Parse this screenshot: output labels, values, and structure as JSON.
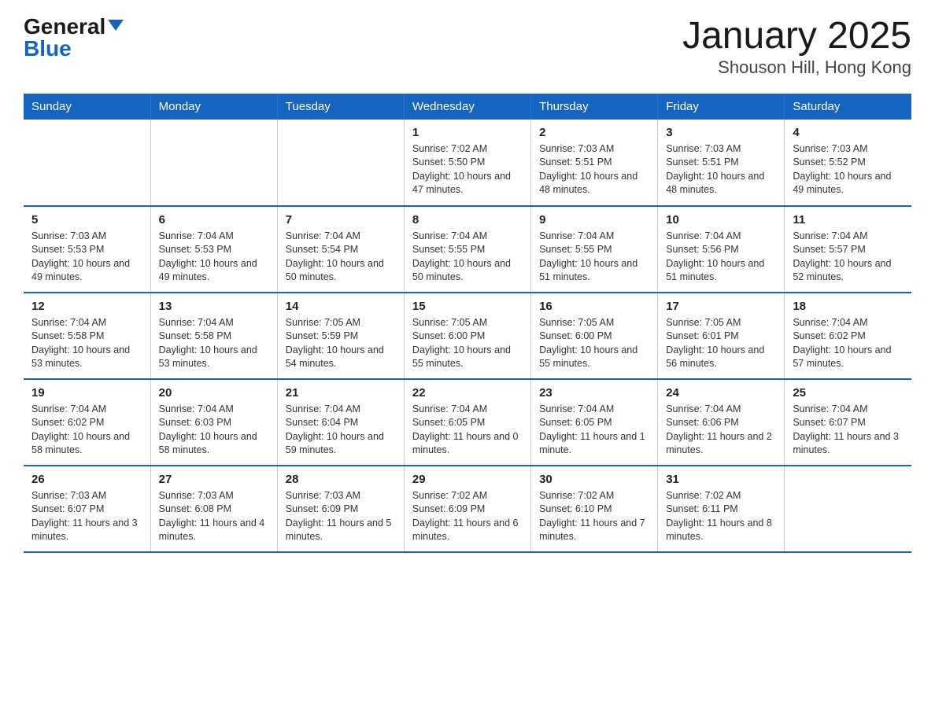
{
  "logo": {
    "general": "General",
    "blue": "Blue"
  },
  "title": "January 2025",
  "subtitle": "Shouson Hill, Hong Kong",
  "days_of_week": [
    "Sunday",
    "Monday",
    "Tuesday",
    "Wednesday",
    "Thursday",
    "Friday",
    "Saturday"
  ],
  "weeks": [
    [
      {
        "day": "",
        "info": ""
      },
      {
        "day": "",
        "info": ""
      },
      {
        "day": "",
        "info": ""
      },
      {
        "day": "1",
        "info": "Sunrise: 7:02 AM\nSunset: 5:50 PM\nDaylight: 10 hours and 47 minutes."
      },
      {
        "day": "2",
        "info": "Sunrise: 7:03 AM\nSunset: 5:51 PM\nDaylight: 10 hours and 48 minutes."
      },
      {
        "day": "3",
        "info": "Sunrise: 7:03 AM\nSunset: 5:51 PM\nDaylight: 10 hours and 48 minutes."
      },
      {
        "day": "4",
        "info": "Sunrise: 7:03 AM\nSunset: 5:52 PM\nDaylight: 10 hours and 49 minutes."
      }
    ],
    [
      {
        "day": "5",
        "info": "Sunrise: 7:03 AM\nSunset: 5:53 PM\nDaylight: 10 hours and 49 minutes."
      },
      {
        "day": "6",
        "info": "Sunrise: 7:04 AM\nSunset: 5:53 PM\nDaylight: 10 hours and 49 minutes."
      },
      {
        "day": "7",
        "info": "Sunrise: 7:04 AM\nSunset: 5:54 PM\nDaylight: 10 hours and 50 minutes."
      },
      {
        "day": "8",
        "info": "Sunrise: 7:04 AM\nSunset: 5:55 PM\nDaylight: 10 hours and 50 minutes."
      },
      {
        "day": "9",
        "info": "Sunrise: 7:04 AM\nSunset: 5:55 PM\nDaylight: 10 hours and 51 minutes."
      },
      {
        "day": "10",
        "info": "Sunrise: 7:04 AM\nSunset: 5:56 PM\nDaylight: 10 hours and 51 minutes."
      },
      {
        "day": "11",
        "info": "Sunrise: 7:04 AM\nSunset: 5:57 PM\nDaylight: 10 hours and 52 minutes."
      }
    ],
    [
      {
        "day": "12",
        "info": "Sunrise: 7:04 AM\nSunset: 5:58 PM\nDaylight: 10 hours and 53 minutes."
      },
      {
        "day": "13",
        "info": "Sunrise: 7:04 AM\nSunset: 5:58 PM\nDaylight: 10 hours and 53 minutes."
      },
      {
        "day": "14",
        "info": "Sunrise: 7:05 AM\nSunset: 5:59 PM\nDaylight: 10 hours and 54 minutes."
      },
      {
        "day": "15",
        "info": "Sunrise: 7:05 AM\nSunset: 6:00 PM\nDaylight: 10 hours and 55 minutes."
      },
      {
        "day": "16",
        "info": "Sunrise: 7:05 AM\nSunset: 6:00 PM\nDaylight: 10 hours and 55 minutes."
      },
      {
        "day": "17",
        "info": "Sunrise: 7:05 AM\nSunset: 6:01 PM\nDaylight: 10 hours and 56 minutes."
      },
      {
        "day": "18",
        "info": "Sunrise: 7:04 AM\nSunset: 6:02 PM\nDaylight: 10 hours and 57 minutes."
      }
    ],
    [
      {
        "day": "19",
        "info": "Sunrise: 7:04 AM\nSunset: 6:02 PM\nDaylight: 10 hours and 58 minutes."
      },
      {
        "day": "20",
        "info": "Sunrise: 7:04 AM\nSunset: 6:03 PM\nDaylight: 10 hours and 58 minutes."
      },
      {
        "day": "21",
        "info": "Sunrise: 7:04 AM\nSunset: 6:04 PM\nDaylight: 10 hours and 59 minutes."
      },
      {
        "day": "22",
        "info": "Sunrise: 7:04 AM\nSunset: 6:05 PM\nDaylight: 11 hours and 0 minutes."
      },
      {
        "day": "23",
        "info": "Sunrise: 7:04 AM\nSunset: 6:05 PM\nDaylight: 11 hours and 1 minute."
      },
      {
        "day": "24",
        "info": "Sunrise: 7:04 AM\nSunset: 6:06 PM\nDaylight: 11 hours and 2 minutes."
      },
      {
        "day": "25",
        "info": "Sunrise: 7:04 AM\nSunset: 6:07 PM\nDaylight: 11 hours and 3 minutes."
      }
    ],
    [
      {
        "day": "26",
        "info": "Sunrise: 7:03 AM\nSunset: 6:07 PM\nDaylight: 11 hours and 3 minutes."
      },
      {
        "day": "27",
        "info": "Sunrise: 7:03 AM\nSunset: 6:08 PM\nDaylight: 11 hours and 4 minutes."
      },
      {
        "day": "28",
        "info": "Sunrise: 7:03 AM\nSunset: 6:09 PM\nDaylight: 11 hours and 5 minutes."
      },
      {
        "day": "29",
        "info": "Sunrise: 7:02 AM\nSunset: 6:09 PM\nDaylight: 11 hours and 6 minutes."
      },
      {
        "day": "30",
        "info": "Sunrise: 7:02 AM\nSunset: 6:10 PM\nDaylight: 11 hours and 7 minutes."
      },
      {
        "day": "31",
        "info": "Sunrise: 7:02 AM\nSunset: 6:11 PM\nDaylight: 11 hours and 8 minutes."
      },
      {
        "day": "",
        "info": ""
      }
    ]
  ]
}
